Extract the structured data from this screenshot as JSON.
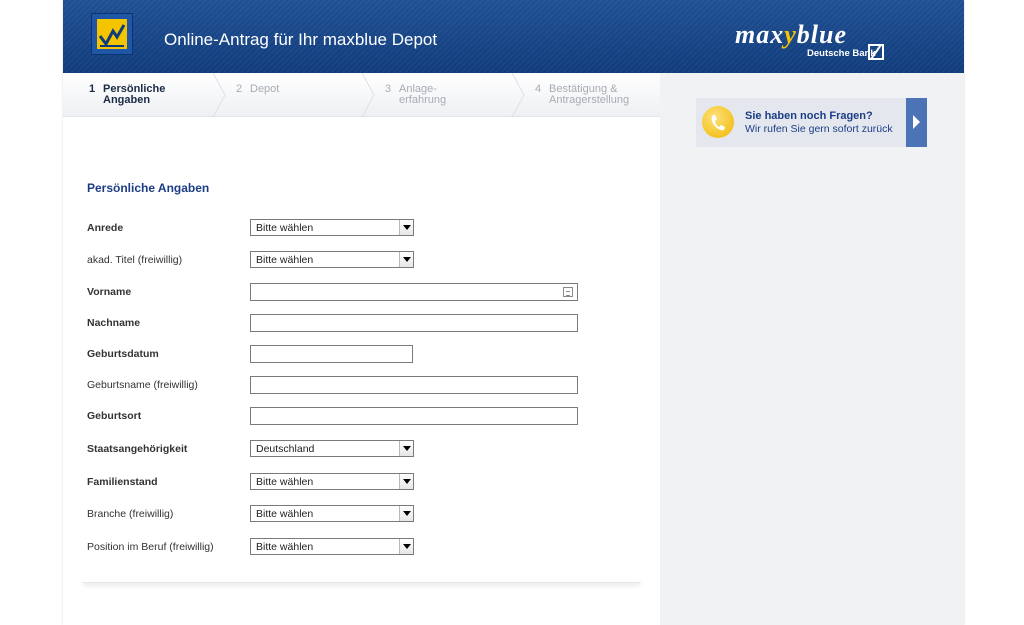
{
  "header": {
    "title": "Online-Antrag für Ihr maxblue Depot",
    "brand_part1": "max",
    "brand_accent": "y",
    "brand_part2": "blue",
    "bank": "Deutsche Bank"
  },
  "steps": [
    {
      "num": "1",
      "label": "Persönliche\nAngaben",
      "active": true
    },
    {
      "num": "2",
      "label": "Depot",
      "active": false
    },
    {
      "num": "3",
      "label": "Anlage-\nerfahrung",
      "active": false
    },
    {
      "num": "4",
      "label": "Bestätigung &\nAntragerstellung",
      "active": false
    }
  ],
  "form": {
    "section_title": "Persönliche Angaben",
    "rows": [
      {
        "label": "Anrede",
        "value": "Bitte wählen"
      },
      {
        "label": "akad. Titel (freiwillig)",
        "value": "Bitte wählen"
      },
      {
        "label": "Vorname",
        "value": ""
      },
      {
        "label": "Nachname",
        "value": ""
      },
      {
        "label": "Geburtsdatum",
        "value": ""
      },
      {
        "label": "Geburtsname (freiwillig)",
        "value": ""
      },
      {
        "label": "Geburtsort",
        "value": ""
      },
      {
        "label": "Staatsangehörigkeit",
        "value": "Deutschland"
      },
      {
        "label": "Familienstand",
        "value": "Bitte wählen"
      },
      {
        "label": "Branche (freiwillig)",
        "value": "Bitte wählen"
      },
      {
        "label": "Position im Beruf (freiwillig)",
        "value": "Bitte wählen"
      }
    ]
  },
  "help": {
    "title": "Sie haben noch Fragen?",
    "subtitle": "Wir rufen Sie gern sofort zurück"
  },
  "colors": {
    "header_blue": "#0f3b7a",
    "accent_yellow": "#f5c400",
    "link_blue": "#1c3d85"
  }
}
